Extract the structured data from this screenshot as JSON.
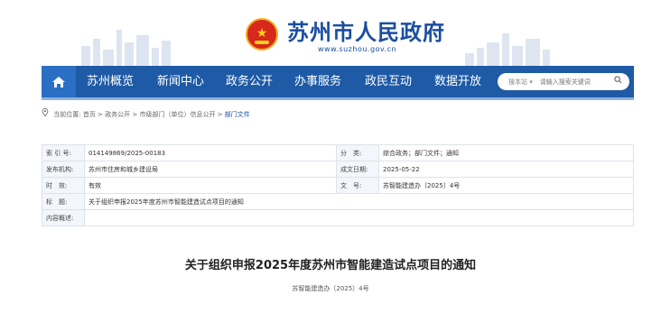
{
  "header": {
    "site_title": "苏州市人民政府",
    "site_url": "www.suzhou.gov.cn",
    "emblem_icon": "national-emblem-icon"
  },
  "nav": {
    "home_icon": "home-icon",
    "items": [
      "苏州概览",
      "新闻中心",
      "政务公开",
      "办事服务",
      "政民互动",
      "数据开放"
    ],
    "search": {
      "scope_label": "搜本站 ▾",
      "placeholder": "请输入搜索关键词"
    }
  },
  "breadcrumb": {
    "prefix": "当前位置:",
    "path": "首页 > 政务公开 > 市级部门（单位）信息公开 > ",
    "current": "部门文件"
  },
  "meta": {
    "index_label": "索 引 号:",
    "index_value": "014149869/2025-00183",
    "category_label": "分　类:",
    "category_value": "综合政务；部门文件；通知",
    "issuer_label": "发布机构:",
    "issuer_value": "苏州市住房和城乡建设局",
    "date_label": "成文日期:",
    "date_value": "2025-05-22",
    "validity_label": "时　效:",
    "validity_value": "有效",
    "docno_label": "文　号:",
    "docno_value": "苏智能建造办〔2025〕4号",
    "title_label": "标　题:",
    "title_value": "关于组织申报2025年度苏州市智能建造试点项目的通知",
    "summary_label": "内容概述:",
    "summary_value": ""
  },
  "document": {
    "title": "关于组织申报2025年度苏州市智能建造试点项目的通知",
    "number": "苏智能建造办〔2025〕4号"
  },
  "colors": {
    "nav_bg": "#1e5aa5",
    "brand_blue": "#1a4ea1"
  }
}
